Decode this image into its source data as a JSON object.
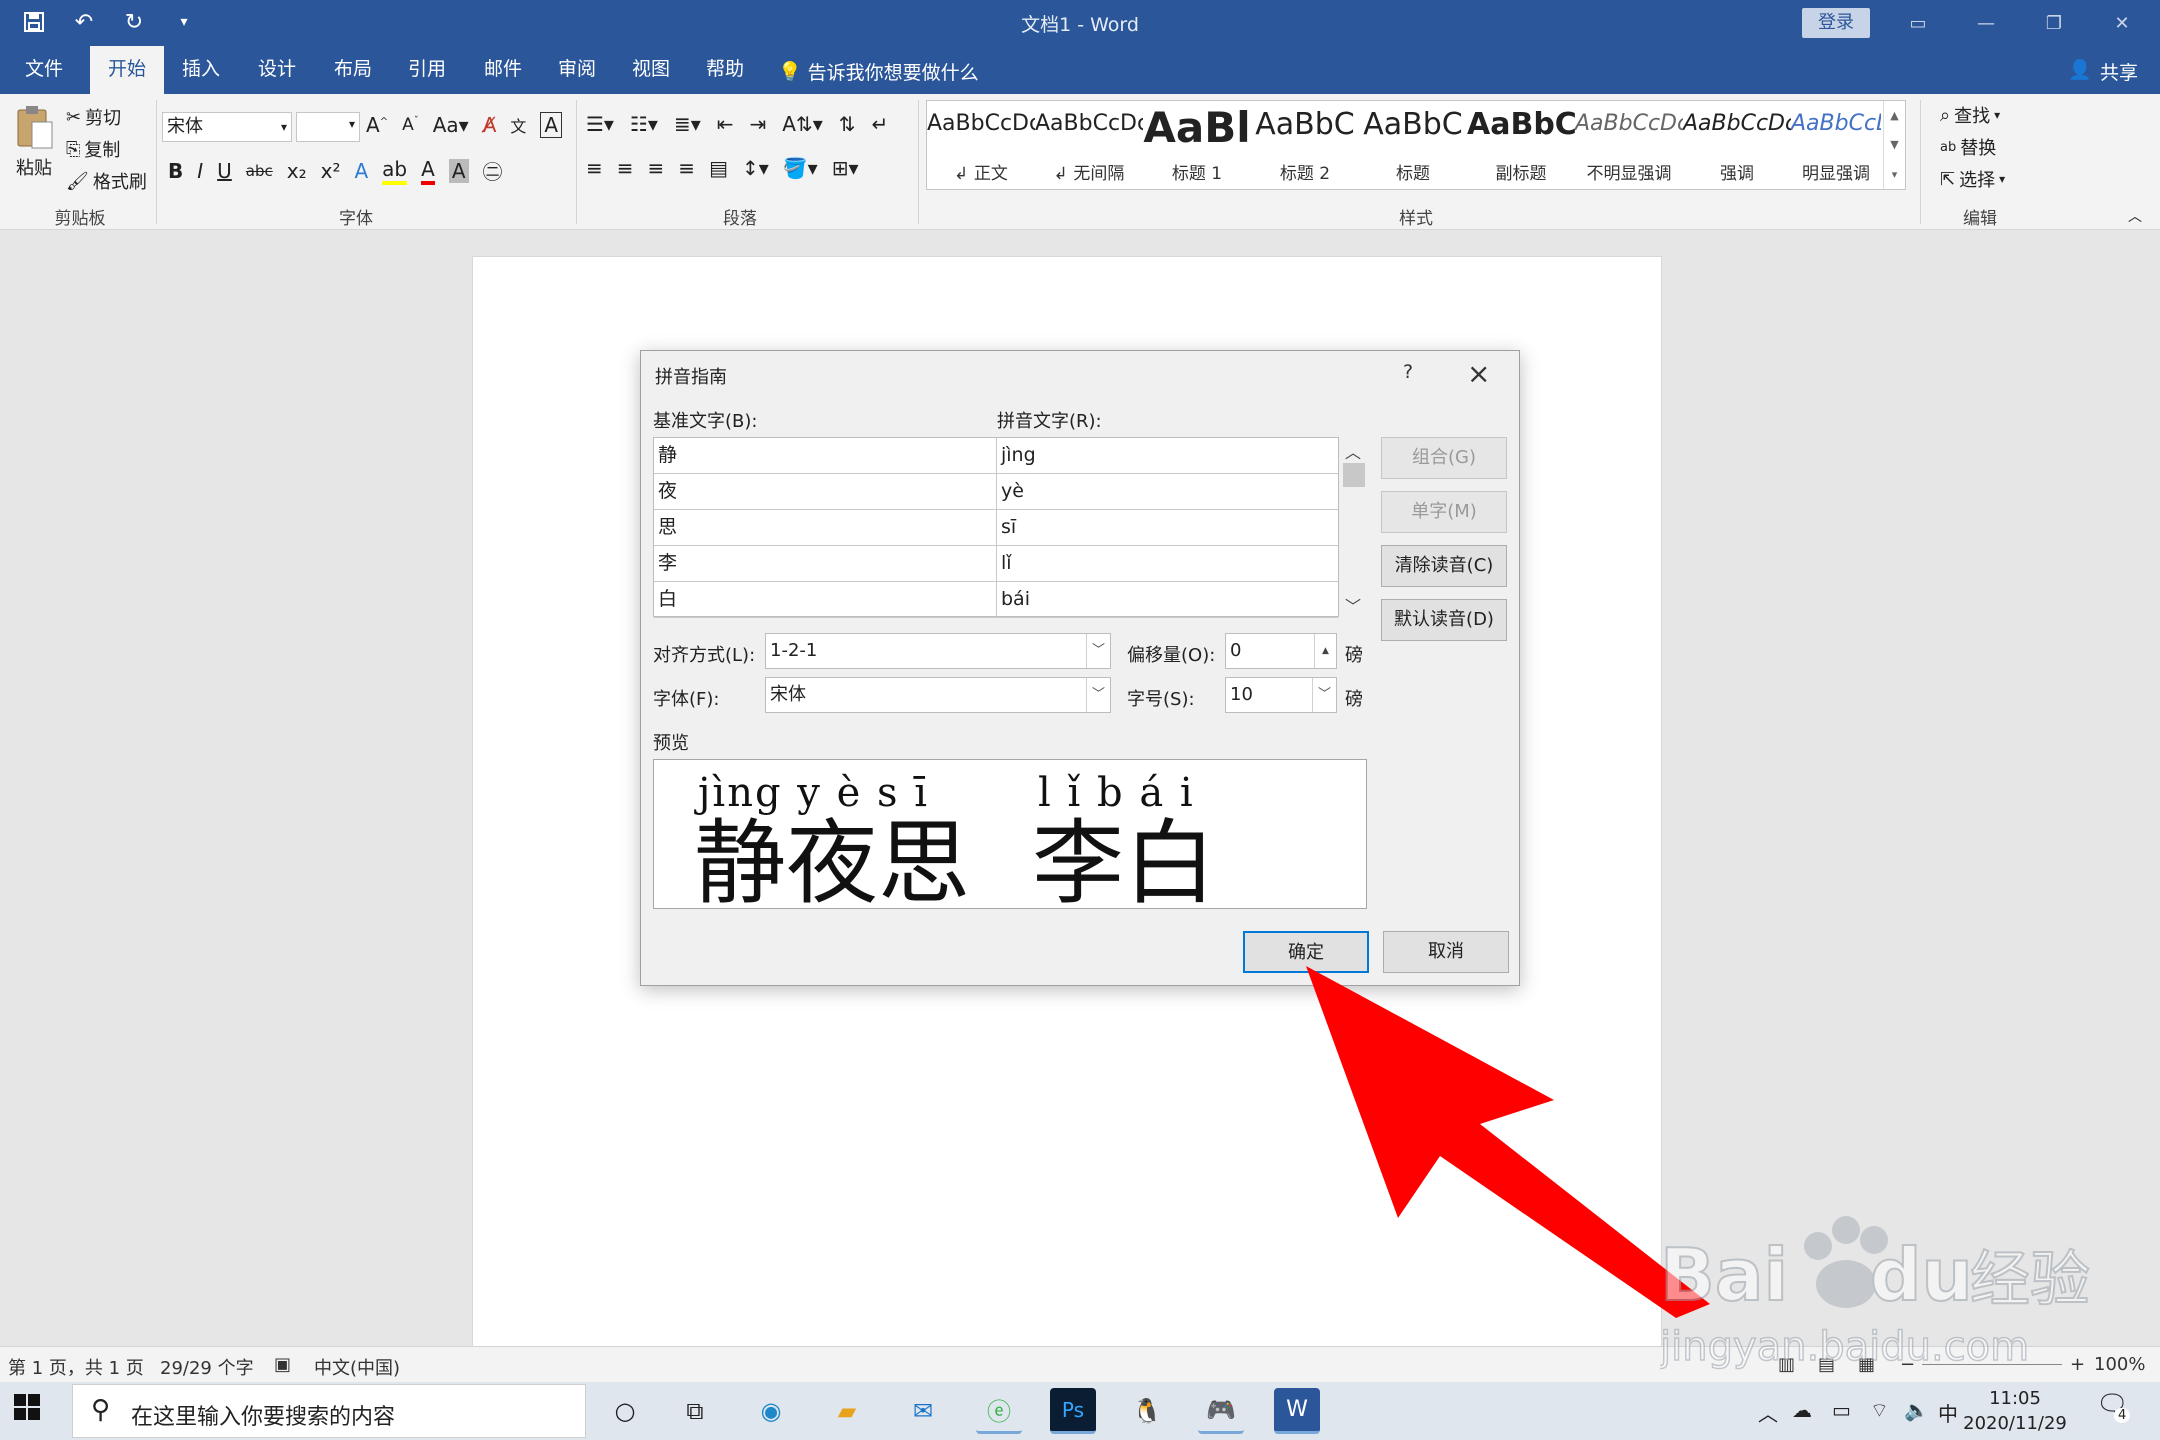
{
  "window": {
    "title": "文档1  -  Word",
    "login": "登录"
  },
  "tabs": [
    "文件",
    "开始",
    "插入",
    "设计",
    "布局",
    "引用",
    "邮件",
    "审阅",
    "视图",
    "帮助"
  ],
  "tell_me": "告诉我你想要做什么",
  "share": "共享",
  "ribbon": {
    "clipboard": {
      "paste": "粘贴",
      "cut": "剪切",
      "copy": "复制",
      "format_painter": "格式刷",
      "label": "剪贴板"
    },
    "font": {
      "name": "宋体",
      "label": "字体"
    },
    "paragraph": {
      "label": "段落"
    },
    "styles": {
      "label": "样式",
      "items": [
        {
          "sample": "AaBbCcDc",
          "name": "↲ 正文"
        },
        {
          "sample": "AaBbCcDc",
          "name": "↲ 无间隔"
        },
        {
          "sample": "AaBl",
          "name": "标题 1"
        },
        {
          "sample": "AaBbC",
          "name": "标题 2"
        },
        {
          "sample": "AaBbC",
          "name": "标题"
        },
        {
          "sample": "AaBbC",
          "name": "副标题"
        },
        {
          "sample": "AaBbCcDc",
          "name": "不明显强调"
        },
        {
          "sample": "AaBbCcDc",
          "name": "强调"
        },
        {
          "sample": "AaBbCcDc",
          "name": "明显强调"
        }
      ]
    },
    "editing": {
      "find": "查找",
      "replace": "替换",
      "select": "选择",
      "label": "编辑"
    }
  },
  "dialog": {
    "title": "拼音指南",
    "help": "?",
    "base_label": "基准文字(B):",
    "pinyin_label": "拼音文字(R):",
    "rows": [
      {
        "base": "静",
        "pinyin": "jìng"
      },
      {
        "base": "夜",
        "pinyin": "yè"
      },
      {
        "base": "思",
        "pinyin": "sī"
      },
      {
        "base": "李",
        "pinyin": "lǐ"
      },
      {
        "base": "白",
        "pinyin": "bái"
      }
    ],
    "buttons": {
      "group": "组合(G)",
      "single": "单字(M)",
      "clear": "清除读音(C)",
      "default": "默认读音(D)",
      "ok": "确定",
      "cancel": "取消"
    },
    "align_label": "对齐方式(L):",
    "align_value": "1-2-1",
    "offset_label": "偏移量(O):",
    "offset_value": "0",
    "font_label": "字体(F):",
    "font_value": "宋体",
    "size_label": "字号(S):",
    "size_value": "10",
    "unit": "磅",
    "preview_label": "预览",
    "preview": {
      "pinyin_1": "jìng y è s ī",
      "chars_1": "静夜思",
      "pinyin_2": "l ǐ b á i",
      "chars_2": "李白"
    }
  },
  "status": {
    "page": "第 1 页，共 1 页",
    "words": "29/29 个字",
    "lang": "中文(中国)",
    "zoom": "100%"
  },
  "taskbar": {
    "search_placeholder": "在这里输入你要搜索的内容",
    "ime": "中",
    "time": "11:05",
    "date": "2020/11/29",
    "notifications": "4"
  },
  "colors": {
    "word_blue": "#2b579a",
    "ribbon_bg": "#f3f3f3",
    "arrow_red": "#ff0000",
    "focus_blue": "#0078d7"
  }
}
